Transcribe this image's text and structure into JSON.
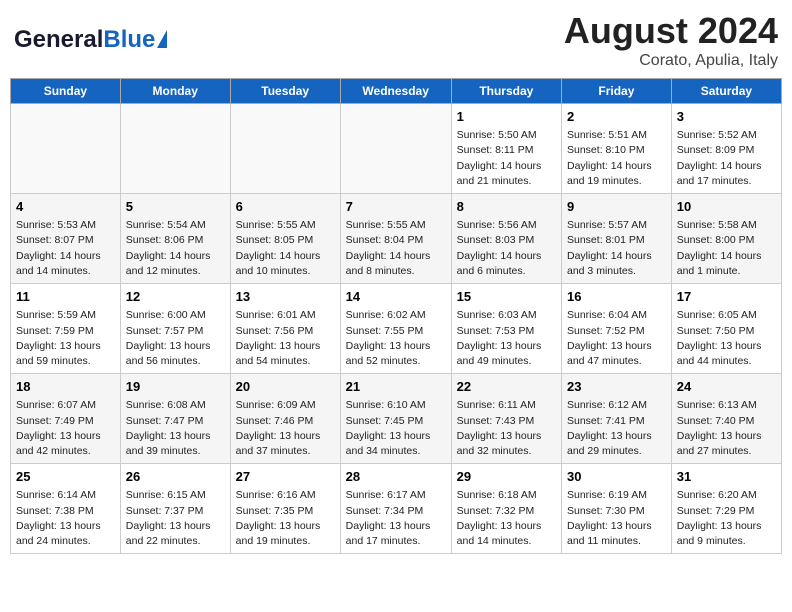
{
  "header": {
    "logo_general": "General",
    "logo_blue": "Blue",
    "main_title": "August 2024",
    "subtitle": "Corato, Apulia, Italy"
  },
  "weekdays": [
    "Sunday",
    "Monday",
    "Tuesday",
    "Wednesday",
    "Thursday",
    "Friday",
    "Saturday"
  ],
  "weeks": [
    [
      {
        "day": "",
        "info": ""
      },
      {
        "day": "",
        "info": ""
      },
      {
        "day": "",
        "info": ""
      },
      {
        "day": "",
        "info": ""
      },
      {
        "day": "1",
        "info": "Sunrise: 5:50 AM\nSunset: 8:11 PM\nDaylight: 14 hours and 21 minutes."
      },
      {
        "day": "2",
        "info": "Sunrise: 5:51 AM\nSunset: 8:10 PM\nDaylight: 14 hours and 19 minutes."
      },
      {
        "day": "3",
        "info": "Sunrise: 5:52 AM\nSunset: 8:09 PM\nDaylight: 14 hours and 17 minutes."
      }
    ],
    [
      {
        "day": "4",
        "info": "Sunrise: 5:53 AM\nSunset: 8:07 PM\nDaylight: 14 hours and 14 minutes."
      },
      {
        "day": "5",
        "info": "Sunrise: 5:54 AM\nSunset: 8:06 PM\nDaylight: 14 hours and 12 minutes."
      },
      {
        "day": "6",
        "info": "Sunrise: 5:55 AM\nSunset: 8:05 PM\nDaylight: 14 hours and 10 minutes."
      },
      {
        "day": "7",
        "info": "Sunrise: 5:55 AM\nSunset: 8:04 PM\nDaylight: 14 hours and 8 minutes."
      },
      {
        "day": "8",
        "info": "Sunrise: 5:56 AM\nSunset: 8:03 PM\nDaylight: 14 hours and 6 minutes."
      },
      {
        "day": "9",
        "info": "Sunrise: 5:57 AM\nSunset: 8:01 PM\nDaylight: 14 hours and 3 minutes."
      },
      {
        "day": "10",
        "info": "Sunrise: 5:58 AM\nSunset: 8:00 PM\nDaylight: 14 hours and 1 minute."
      }
    ],
    [
      {
        "day": "11",
        "info": "Sunrise: 5:59 AM\nSunset: 7:59 PM\nDaylight: 13 hours and 59 minutes."
      },
      {
        "day": "12",
        "info": "Sunrise: 6:00 AM\nSunset: 7:57 PM\nDaylight: 13 hours and 56 minutes."
      },
      {
        "day": "13",
        "info": "Sunrise: 6:01 AM\nSunset: 7:56 PM\nDaylight: 13 hours and 54 minutes."
      },
      {
        "day": "14",
        "info": "Sunrise: 6:02 AM\nSunset: 7:55 PM\nDaylight: 13 hours and 52 minutes."
      },
      {
        "day": "15",
        "info": "Sunrise: 6:03 AM\nSunset: 7:53 PM\nDaylight: 13 hours and 49 minutes."
      },
      {
        "day": "16",
        "info": "Sunrise: 6:04 AM\nSunset: 7:52 PM\nDaylight: 13 hours and 47 minutes."
      },
      {
        "day": "17",
        "info": "Sunrise: 6:05 AM\nSunset: 7:50 PM\nDaylight: 13 hours and 44 minutes."
      }
    ],
    [
      {
        "day": "18",
        "info": "Sunrise: 6:07 AM\nSunset: 7:49 PM\nDaylight: 13 hours and 42 minutes."
      },
      {
        "day": "19",
        "info": "Sunrise: 6:08 AM\nSunset: 7:47 PM\nDaylight: 13 hours and 39 minutes."
      },
      {
        "day": "20",
        "info": "Sunrise: 6:09 AM\nSunset: 7:46 PM\nDaylight: 13 hours and 37 minutes."
      },
      {
        "day": "21",
        "info": "Sunrise: 6:10 AM\nSunset: 7:45 PM\nDaylight: 13 hours and 34 minutes."
      },
      {
        "day": "22",
        "info": "Sunrise: 6:11 AM\nSunset: 7:43 PM\nDaylight: 13 hours and 32 minutes."
      },
      {
        "day": "23",
        "info": "Sunrise: 6:12 AM\nSunset: 7:41 PM\nDaylight: 13 hours and 29 minutes."
      },
      {
        "day": "24",
        "info": "Sunrise: 6:13 AM\nSunset: 7:40 PM\nDaylight: 13 hours and 27 minutes."
      }
    ],
    [
      {
        "day": "25",
        "info": "Sunrise: 6:14 AM\nSunset: 7:38 PM\nDaylight: 13 hours and 24 minutes."
      },
      {
        "day": "26",
        "info": "Sunrise: 6:15 AM\nSunset: 7:37 PM\nDaylight: 13 hours and 22 minutes."
      },
      {
        "day": "27",
        "info": "Sunrise: 6:16 AM\nSunset: 7:35 PM\nDaylight: 13 hours and 19 minutes."
      },
      {
        "day": "28",
        "info": "Sunrise: 6:17 AM\nSunset: 7:34 PM\nDaylight: 13 hours and 17 minutes."
      },
      {
        "day": "29",
        "info": "Sunrise: 6:18 AM\nSunset: 7:32 PM\nDaylight: 13 hours and 14 minutes."
      },
      {
        "day": "30",
        "info": "Sunrise: 6:19 AM\nSunset: 7:30 PM\nDaylight: 13 hours and 11 minutes."
      },
      {
        "day": "31",
        "info": "Sunrise: 6:20 AM\nSunset: 7:29 PM\nDaylight: 13 hours and 9 minutes."
      }
    ]
  ]
}
